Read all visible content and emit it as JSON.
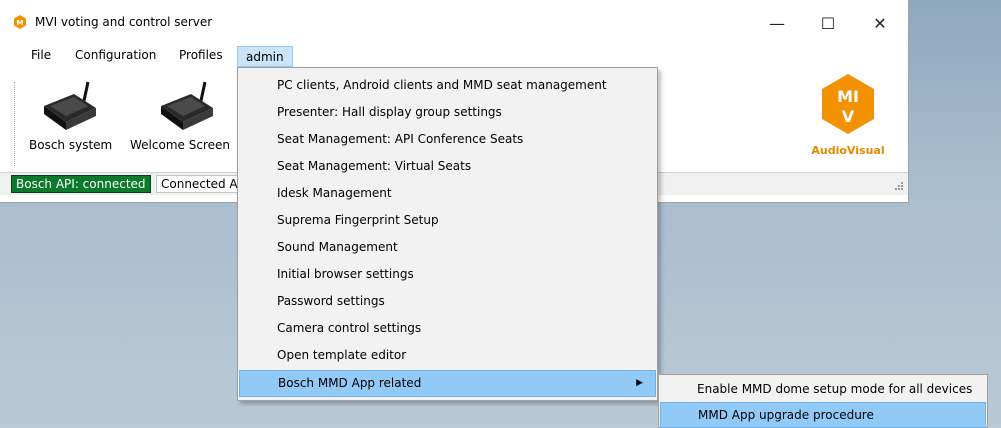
{
  "window": {
    "title": "MVI voting and control server",
    "icon": "mvi-app-icon",
    "controls": {
      "minimize": "—",
      "maximize": "☐",
      "close": "✕"
    }
  },
  "menubar": {
    "items": [
      "File",
      "Configuration",
      "Profiles",
      "admin"
    ],
    "active": "admin"
  },
  "toolbar": {
    "buttons": [
      {
        "label": "Bosch system",
        "icon": "bosch-device-icon"
      },
      {
        "label": "Welcome Screen",
        "icon": "welcome-device-icon"
      }
    ]
  },
  "logo": {
    "top": "MI",
    "bottom": "V",
    "text": "AudioVisual",
    "color": "#f39200"
  },
  "statusbar": {
    "api": "Bosch API: connected",
    "connected": "Connected A"
  },
  "admin_menu": {
    "items": [
      "PC clients, Android clients and MMD seat management",
      "Presenter: Hall display group settings",
      "Seat Management: API Conference Seats",
      "Seat Management: Virtual Seats",
      "Idesk Management",
      "Suprema Fingerprint Setup",
      "Sound Management",
      "Initial browser settings",
      "Password settings",
      "Camera control settings",
      "Open template editor",
      "Bosch MMD App related"
    ],
    "highlighted_index": 11,
    "submenu_arrow": "▶"
  },
  "submenu": {
    "items": [
      "Enable MMD dome setup mode for all devices",
      "MMD App upgrade procedure"
    ],
    "highlighted_index": 1
  }
}
